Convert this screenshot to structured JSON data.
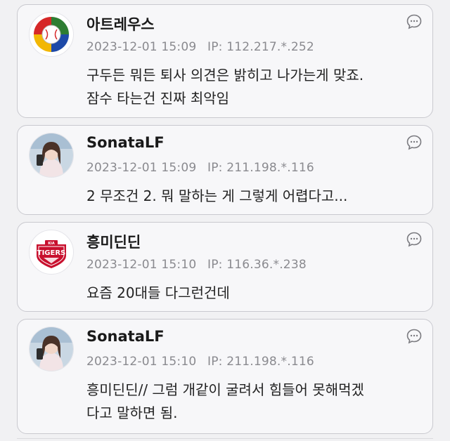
{
  "comments": [
    {
      "username": "아트레우스",
      "date": "2023-12-01 15:09",
      "ip": "IP: 112.217.*.252",
      "lines": [
        "구두든 뭐든 퇴사 의견은 밝히고 나가는게 맞죠.",
        "잠수 타는건 진짜 최악임"
      ],
      "avatar": "baseball-logo-icon"
    },
    {
      "username": "SonataLF",
      "date": "2023-12-01 15:09",
      "ip": "IP: 211.198.*.116",
      "lines": [
        "2 무조건 2. 뭐 말하는 게 그렇게 어렵다고..."
      ],
      "avatar": "user-photo-avatar"
    },
    {
      "username": "흥미딘딘",
      "date": "2023-12-01 15:10",
      "ip": "IP: 116.36.*.238",
      "lines": [
        "요즘 20대들 다그런건데"
      ],
      "avatar": "tigers-logo-icon",
      "avatar_text": {
        "top": "KIA",
        "main": "TIGERS"
      }
    },
    {
      "username": "SonataLF",
      "date": "2023-12-01 15:10",
      "ip": "IP: 211.198.*.116",
      "lines": [
        "흥미딘딘// 그럼 개같이 굴려서 힘들어 못해먹겠",
        "다고 말하면 됨."
      ],
      "avatar": "user-photo-avatar"
    }
  ],
  "icons": {
    "reply": "speech-bubble-icon"
  },
  "colors": {
    "background": "#f1f1f3",
    "card": "#f7f7f9",
    "border": "#c9c9cf",
    "meta": "#8a8a8f",
    "tigers_red": "#c8102e"
  }
}
